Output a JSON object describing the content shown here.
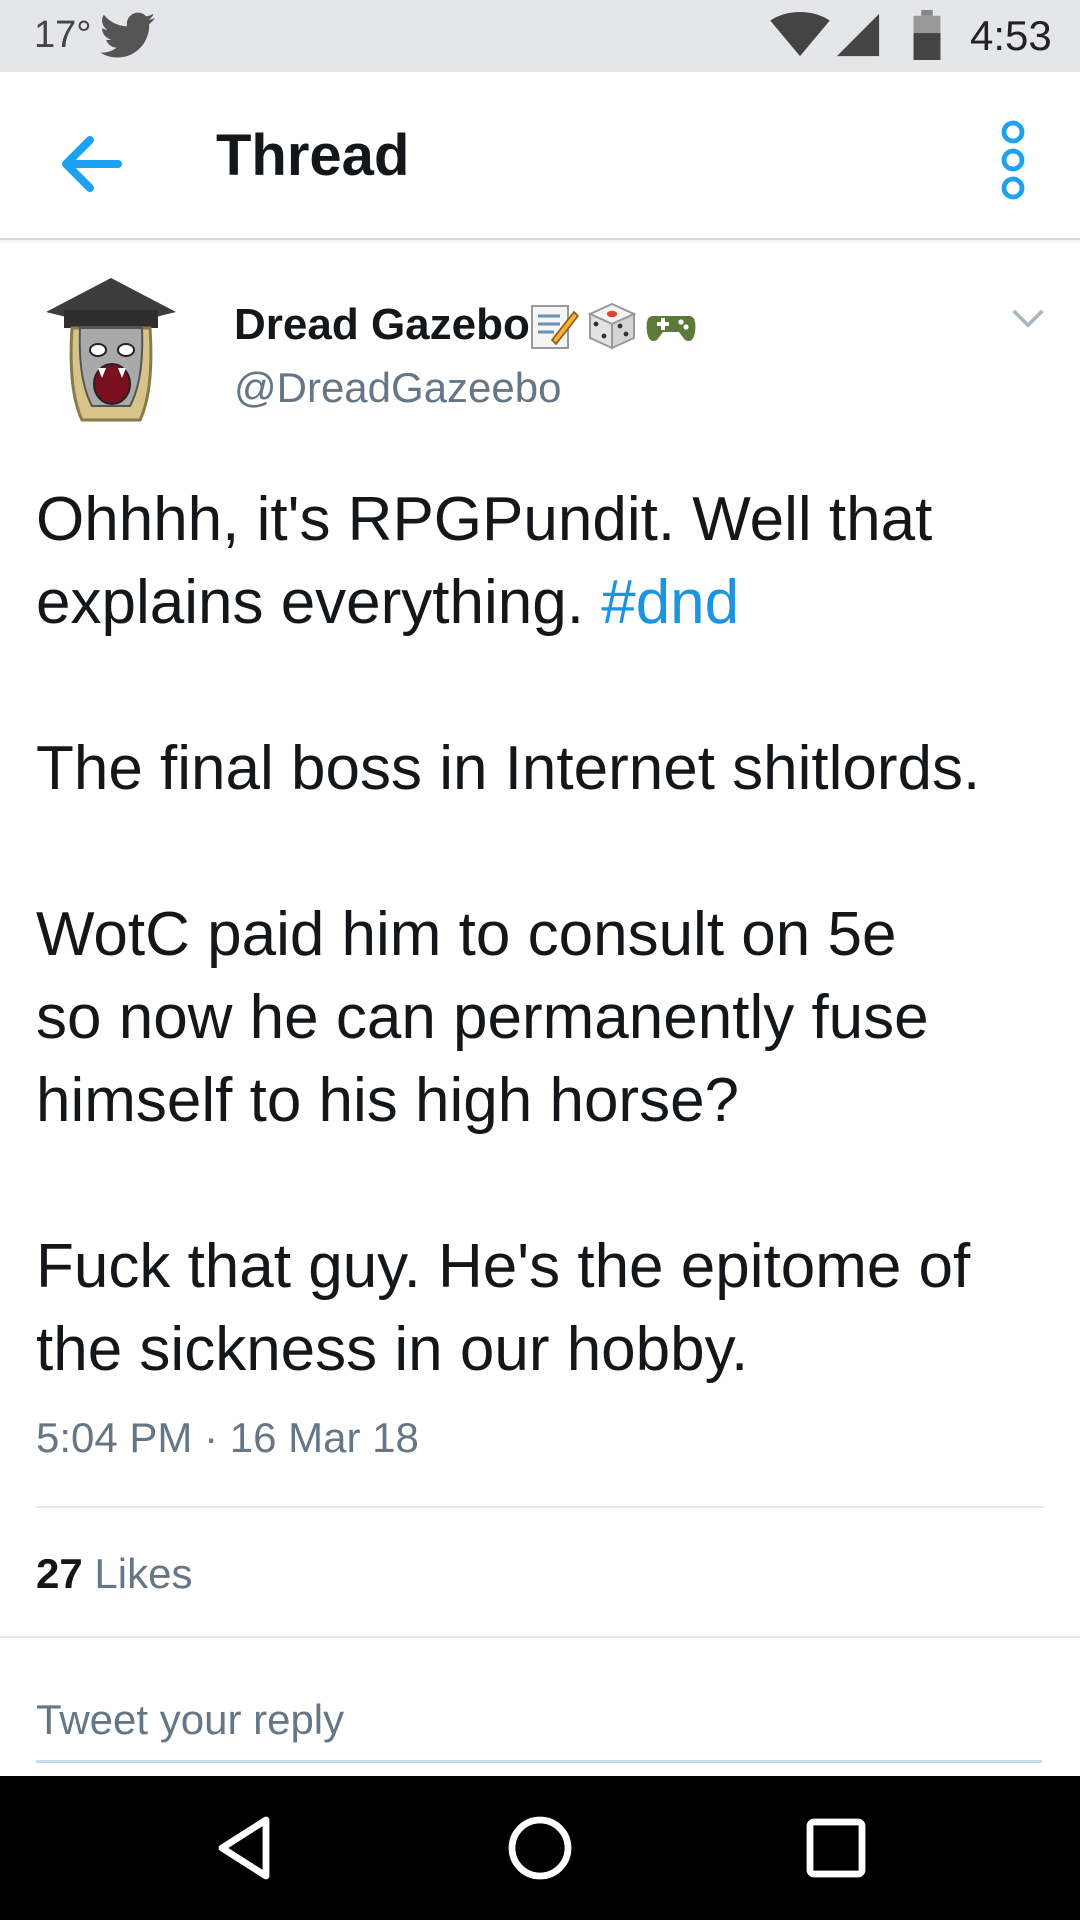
{
  "status_bar": {
    "temperature": "17°",
    "time": "4:53"
  },
  "app_bar": {
    "title": "Thread"
  },
  "tweet": {
    "author_name": "Dread Gazebo",
    "author_handle": "@DreadGazeebo",
    "name_badges": [
      "memo-icon",
      "dice-icon",
      "game-controller-icon"
    ],
    "text_line1": "Ohhhh, it's RPGPundit. Well that",
    "text_line2_prefix": "explains everything. ",
    "hashtag": "#dnd",
    "paragraph2": "The final boss in Internet shitlords.",
    "paragraph3_line1": "WotC paid him to consult on 5e",
    "paragraph3_line2": "so now he can permanently fuse",
    "paragraph3_line3": "himself to his high horse?",
    "paragraph4_line1": "Fuck that guy. He's the epitome of",
    "paragraph4_line2": "the sickness in our hobby.",
    "timestamp": "5:04 PM · 16 Mar 18",
    "likes_count": "27",
    "likes_label": "Likes"
  },
  "reply": {
    "placeholder": "Tweet your reply"
  },
  "colors": {
    "accent": "#1da1f2",
    "hashtag": "#1b95e0",
    "secondary_text": "#657786",
    "status_bar_bg": "#e4e6e9",
    "nav_bar_bg": "#000000"
  }
}
